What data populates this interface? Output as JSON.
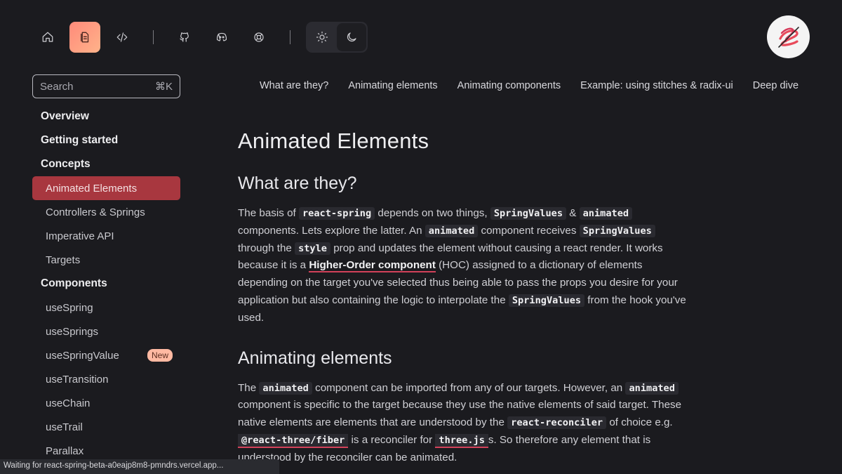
{
  "toolbar": {
    "icons": [
      "home-icon",
      "docs-icon",
      "code-icon",
      "github-icon",
      "discord-icon",
      "help-icon",
      "sun-icon",
      "moon-icon"
    ],
    "accent": "#ff9a80"
  },
  "search": {
    "placeholder": "Search",
    "shortcut": "⌘K"
  },
  "sidebar": {
    "overview": "Overview",
    "getting_started": "Getting started",
    "concepts": "Concepts",
    "concepts_items": [
      "Animated Elements",
      "Controllers & Springs",
      "Imperative API",
      "Targets"
    ],
    "components": "Components",
    "components_items": [
      "useSpring",
      "useSprings",
      "useSpringValue",
      "useTransition",
      "useChain",
      "useTrail",
      "Parallax"
    ],
    "new_badge": "New",
    "active_color": "#a8373f"
  },
  "tabs": [
    "What are they?",
    "Animating elements",
    "Animating components",
    "Example: using stitches & radix-ui",
    "Deep dive"
  ],
  "content": {
    "title": "Animated Elements",
    "s1_heading": "What are they?",
    "p1": {
      "t1": "The basis of ",
      "c1": "react-spring",
      "t2": " depends on two things, ",
      "c2": "SpringValues",
      "t3": " & ",
      "c3": "animated",
      "t4": " components. Lets explore the latter. An ",
      "c4": "animated",
      "t5": " component receives ",
      "c5": "SpringValues",
      "t6": " through the ",
      "c6": "style",
      "t7": " prop and updates the element without causing a react render. It works because it is a ",
      "link": "Higher-Order component",
      "t8": " (HOC) assigned to a dictionary of elements depending on the target you've selected thus being able to pass the props you desire for your application but also containing the logic to interpolate the ",
      "c7": "SpringValues",
      "t9": " from the hook you've used."
    },
    "s2_heading": "Animating elements",
    "p2": {
      "t1": "The ",
      "c1": "animated",
      "t2": " component can be imported from any of our targets. However, an ",
      "c2": "animated",
      "t3": " component is specific to the target because they use the native elements of said target. These native elements are elements that are understood by the ",
      "c3": "react-reconciler",
      "t4": " of choice e.g. ",
      "c4": "@react-three/fiber",
      "t5": " is a reconciler for ",
      "c5": "three.js",
      "t6": "s. So therefore any element that is understood by the reconciler can be animated."
    }
  },
  "status": "Waiting for react-spring-beta-a0eajp8m8-pmndrs.vercel.app..."
}
